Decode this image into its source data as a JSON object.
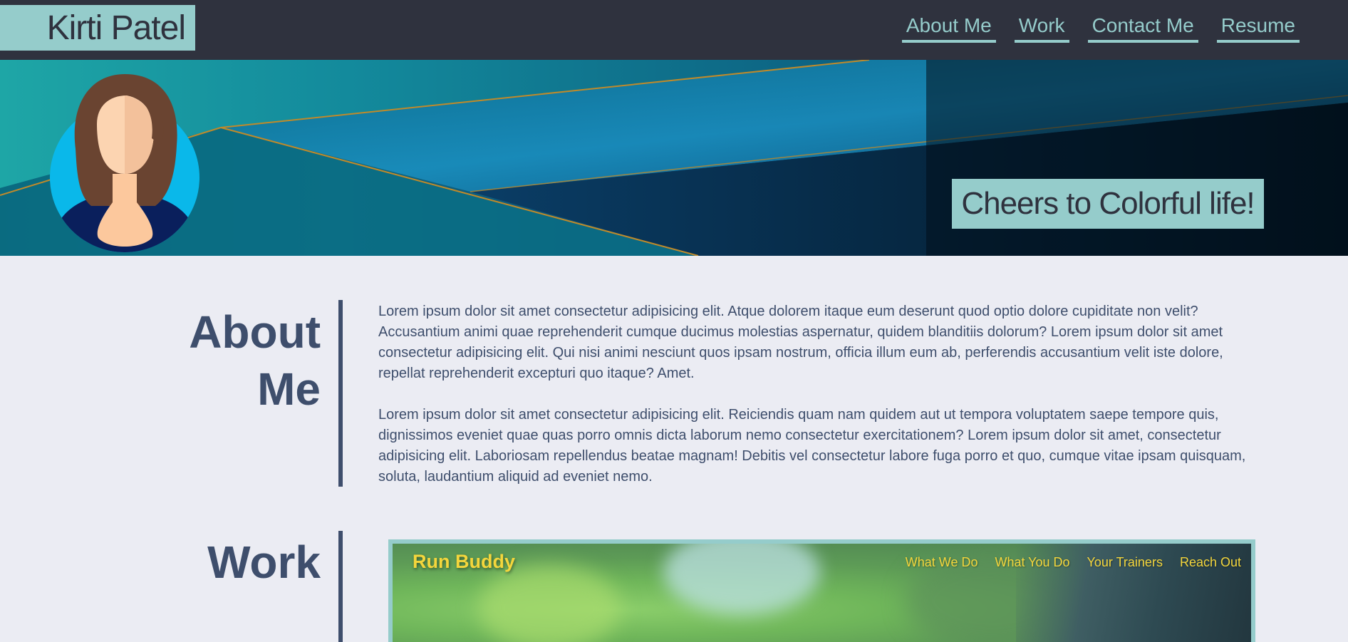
{
  "header": {
    "brand": "Kirti Patel",
    "nav": [
      "About Me",
      "Work",
      "Contact Me",
      "Resume"
    ]
  },
  "hero": {
    "tagline": "Cheers to Colorful life!"
  },
  "about": {
    "title_line1": "About",
    "title_line2": "Me",
    "paragraphs": [
      "Lorem ipsum dolor sit amet consectetur adipisicing elit. Atque dolorem itaque eum deserunt quod optio dolore cupiditate non velit? Accusantium animi quae reprehenderit cumque ducimus molestias aspernatur, quidem blanditiis dolorum? Lorem ipsum dolor sit amet consectetur adipisicing elit. Qui nisi animi nesciunt quos ipsam nostrum, officia illum eum ab, perferendis accusantium velit iste dolore, repellat reprehenderit excepturi quo itaque? Amet.",
      "Lorem ipsum dolor sit amet consectetur adipisicing elit. Reiciendis quam nam quidem aut ut tempora voluptatem saepe tempore quis, dignissimos eveniet quae quas porro omnis dicta laborum nemo consectetur exercitationem? Lorem ipsum dolor sit amet, consectetur adipisicing elit. Laboriosam repellendus beatae magnam! Debitis vel consectetur labore fuga porro et quo, cumque vitae ipsam quisquam, soluta, laudantium aliquid ad eveniet nemo."
    ]
  },
  "work": {
    "title": "Work",
    "project": {
      "name": "Run Buddy",
      "nav": [
        "What We Do",
        "What You Do",
        "Your Trainers",
        "Reach Out"
      ]
    }
  },
  "colors": {
    "header_bg": "#2f323e",
    "accent": "#95cccb",
    "page_bg": "#ebecf3",
    "text": "#3e4e6c",
    "runbuddy_yellow": "#f4d63c"
  },
  "icons": {
    "avatar": "woman-avatar-icon"
  }
}
